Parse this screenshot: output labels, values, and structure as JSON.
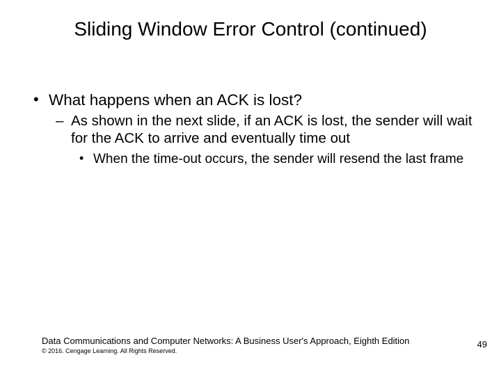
{
  "title": "Sliding Window Error Control (continued)",
  "bullets": {
    "lvl1": "What happens when an ACK is lost?",
    "lvl2": "As shown in the next slide, if an ACK is lost, the sender will wait for the ACK to arrive and eventually time out",
    "lvl3": "When the time-out occurs, the sender will resend the last frame"
  },
  "footer": {
    "book": "Data Communications and Computer Networks: A Business User's Approach, Eighth Edition",
    "copyright": "© 2016. Cengage Learning. All Rights Reserved."
  },
  "page_number": "49"
}
